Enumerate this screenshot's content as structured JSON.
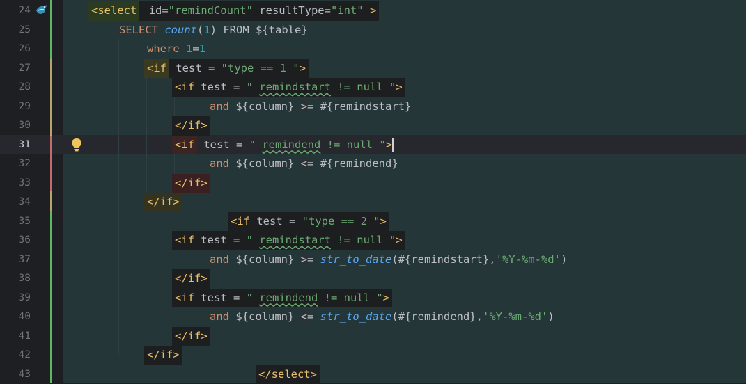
{
  "editor": {
    "line_numbers": [
      "24",
      "25",
      "26",
      "27",
      "28",
      "29",
      "30",
      "31",
      "32",
      "33",
      "34",
      "35",
      "36",
      "37",
      "38",
      "39",
      "40",
      "41",
      "42",
      "43"
    ],
    "current_line": "31"
  },
  "code": {
    "l24": {
      "a": "<select",
      "b": " id=",
      "c": "\"remindCount\"",
      "d": " resultType=",
      "e": "\"int\"",
      "f": " >"
    },
    "l25": {
      "a": "SELECT ",
      "b": "count",
      "c": "(",
      "d": "1",
      "e": ") FROM ${table}"
    },
    "l26": {
      "a": "where ",
      "b": "1",
      "c": "=",
      "d": "1"
    },
    "l27": {
      "a": "<if",
      "b": " test = ",
      "c": "\"type == 1 \"",
      "d": ">"
    },
    "l28": {
      "a": "<if",
      "b": " test = ",
      "c": "\" ",
      "d": "remindstart",
      "e": " != null \"",
      "f": ">"
    },
    "l29": {
      "a": "and",
      "b": " ${column} ",
      "c": ">",
      "d": "= #{remindstart}"
    },
    "l30": {
      "a": "</if>"
    },
    "l31": {
      "a": "<if",
      "b": " test = ",
      "c": "\" ",
      "d": "remindend",
      "e": " != null \"",
      "f": ">"
    },
    "l32": {
      "a": "and",
      "b": " ${column} ",
      "c": "<",
      "d": "= #{remindend}"
    },
    "l33": {
      "a": "</if>"
    },
    "l34": {
      "a": "</if>"
    },
    "l35": {
      "a": "<if",
      "b": " test = ",
      "c": "\"type == 2 \"",
      "d": ">"
    },
    "l36": {
      "a": "<if",
      "b": " test = ",
      "c": "\" ",
      "d": "remindstart",
      "e": " != null \"",
      "f": ">"
    },
    "l37": {
      "a": "and",
      "b": " ${column} ",
      "c": ">",
      "d": "= ",
      "e": "str_to_date",
      "f": "(#{remindstart},",
      "g": "'%Y-%m-%d'",
      "h": ")"
    },
    "l38": {
      "a": "</if>"
    },
    "l39": {
      "a": "<if",
      "b": " test = ",
      "c": "\" ",
      "d": "remindend",
      "e": " != null \"",
      "f": ">"
    },
    "l40": {
      "a": "and",
      "b": " ${column} ",
      "c": "<",
      "d": "= ",
      "e": "str_to_date",
      "f": "(#{remindend},",
      "g": "'%Y-%m-%d'",
      "h": ")"
    },
    "l41": {
      "a": "</if>"
    },
    "l42": {
      "a": "</if>"
    },
    "l43": {
      "a": "</select>"
    }
  },
  "colors": {
    "background": "#1e1f22",
    "code_background": "#253638",
    "tag": "#e8bf6a",
    "string": "#6aab73",
    "keyword": "#cf8e6d",
    "number": "#2aacb8",
    "function": "#56a8f5",
    "added_bar": "#5fb865",
    "modified_bar": "#b9a46a",
    "deleted_bar": "#c26b6b"
  },
  "icons": {
    "gutter_mapper_icon": "bird-icon",
    "intention_icon": "lightbulb-icon"
  }
}
